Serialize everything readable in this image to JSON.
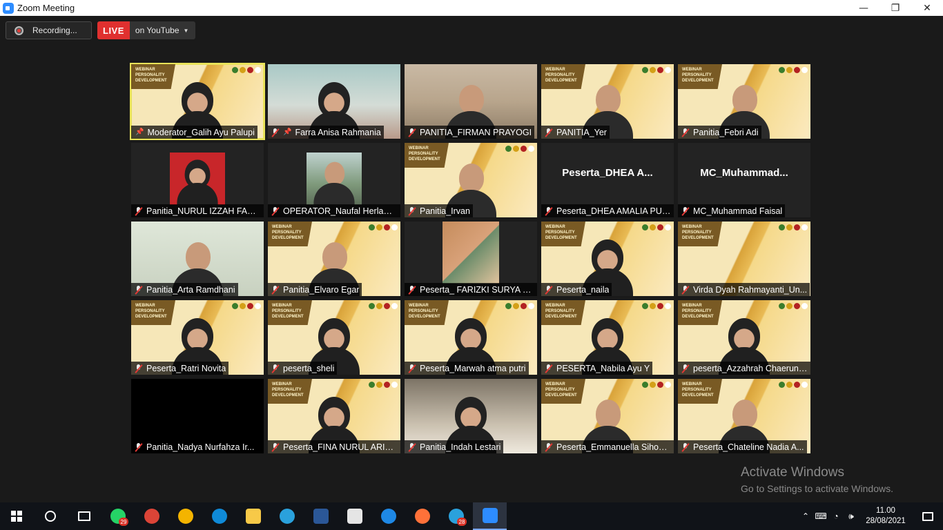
{
  "window": {
    "title": "Zoom Meeting",
    "minimize": "—",
    "maximize": "❐",
    "close": "✕"
  },
  "toolbar": {
    "recording_label": "Recording...",
    "live_label": "LIVE",
    "live_destination": "on YouTube",
    "live_caret": "▼"
  },
  "participants": [
    {
      "name": "Moderator_Galih Ayu Palupi",
      "muted": false,
      "pinned": true,
      "active": true,
      "bg": "webinar",
      "video": "hijab"
    },
    {
      "name": "Farra Anisa Rahmania",
      "muted": true,
      "pinned": true,
      "bg": "teal",
      "video": "hijab"
    },
    {
      "name": "PANITIA_FIRMAN PRAYOGI",
      "muted": true,
      "bg": "room",
      "video": "person"
    },
    {
      "name": "PANITIA_Yer",
      "muted": true,
      "bg": "webinar",
      "video": "person"
    },
    {
      "name": "Panitia_Febri Adi",
      "muted": true,
      "bg": "webinar",
      "video": "person"
    },
    {
      "name": "Panitia_NURUL IZZAH FAUZ...",
      "muted": true,
      "bg": "dark",
      "video": "photo-red"
    },
    {
      "name": "OPERATOR_Naufal Herlam...",
      "muted": true,
      "bg": "dark",
      "video": "photo-outdoor"
    },
    {
      "name": "Panitia_Irvan",
      "muted": true,
      "bg": "webinar",
      "video": "person"
    },
    {
      "name": "Peserta_DHEA AMALIA PUS...",
      "muted": true,
      "bg": "dark",
      "video": "none",
      "display_name": "Peserta_DHEA A..."
    },
    {
      "name": "MC_Muhammad Faisal",
      "muted": true,
      "bg": "dark",
      "video": "none",
      "display_name": "MC_Muhammad..."
    },
    {
      "name": "Panitia_Arta Ramdhani",
      "muted": true,
      "bg": "light",
      "video": "person"
    },
    {
      "name": "Panitia_Elvaro Egar",
      "muted": true,
      "bg": "webinar",
      "video": "person"
    },
    {
      "name": "Peserta_ FARIZKI SURYA PU...",
      "muted": true,
      "bg": "dark",
      "video": "doc"
    },
    {
      "name": "Peserta_naila",
      "muted": true,
      "bg": "webinar",
      "video": "hijab"
    },
    {
      "name": "Virda Dyah Rahmayanti_Un...",
      "muted": true,
      "bg": "webinar",
      "video": "none"
    },
    {
      "name": "Peserta_Ratri Novita",
      "muted": true,
      "bg": "webinar",
      "video": "hijab"
    },
    {
      "name": "peserta_sheli",
      "muted": true,
      "bg": "webinar",
      "video": "hijab"
    },
    {
      "name": "Peserta_Marwah atma putri",
      "muted": true,
      "bg": "webinar",
      "video": "hijab"
    },
    {
      "name": "PESERTA_Nabila Ayu Y",
      "muted": true,
      "bg": "webinar",
      "video": "hijab"
    },
    {
      "name": "peserta_Azzahrah Chaeruni...",
      "muted": true,
      "bg": "webinar",
      "video": "hijab"
    },
    {
      "name": "Panitia_Nadya Nurfahza Ir...",
      "muted": true,
      "bg": "black",
      "video": "none"
    },
    {
      "name": "Peserta_FINA NURUL ARIFAH",
      "muted": true,
      "bg": "webinar",
      "video": "hijab"
    },
    {
      "name": "Panitia_Indah Lestari",
      "muted": true,
      "bg": "room2",
      "video": "hijab"
    },
    {
      "name": "Peserta_Emmanuella Sihom...",
      "muted": true,
      "bg": "webinar",
      "video": "person"
    },
    {
      "name": "Peserta_Chateline Nadia A...",
      "muted": true,
      "bg": "webinar",
      "video": "person"
    }
  ],
  "watermark": {
    "line1": "Activate Windows",
    "line2": "Go to Settings to activate Windows."
  },
  "taskbar": {
    "apps": [
      {
        "name": "search-icon",
        "color": "#ffffff"
      },
      {
        "name": "task-view-icon",
        "color": "#ffffff"
      },
      {
        "name": "whatsapp-icon",
        "color": "#25d366",
        "badge": "29"
      },
      {
        "name": "chrome-icon",
        "color": "#db4437"
      },
      {
        "name": "chrome-icon",
        "color": "#f4b400"
      },
      {
        "name": "edge-icon",
        "color": "#0f8ad8"
      },
      {
        "name": "file-explorer-icon",
        "color": "#f7c948"
      },
      {
        "name": "telegram-icon",
        "color": "#2aa1dc"
      },
      {
        "name": "word-icon",
        "color": "#2b5797"
      },
      {
        "name": "store-icon",
        "color": "#e5e5e5"
      },
      {
        "name": "internet-explorer-icon",
        "color": "#1e88e5"
      },
      {
        "name": "firefox-icon",
        "color": "#ff7139"
      },
      {
        "name": "telegram-icon",
        "color": "#2aa1dc",
        "badge": "28"
      },
      {
        "name": "zoom-icon",
        "color": "#2d8cff",
        "active": true
      }
    ],
    "time": "11.00",
    "date": "28/08/2021"
  }
}
